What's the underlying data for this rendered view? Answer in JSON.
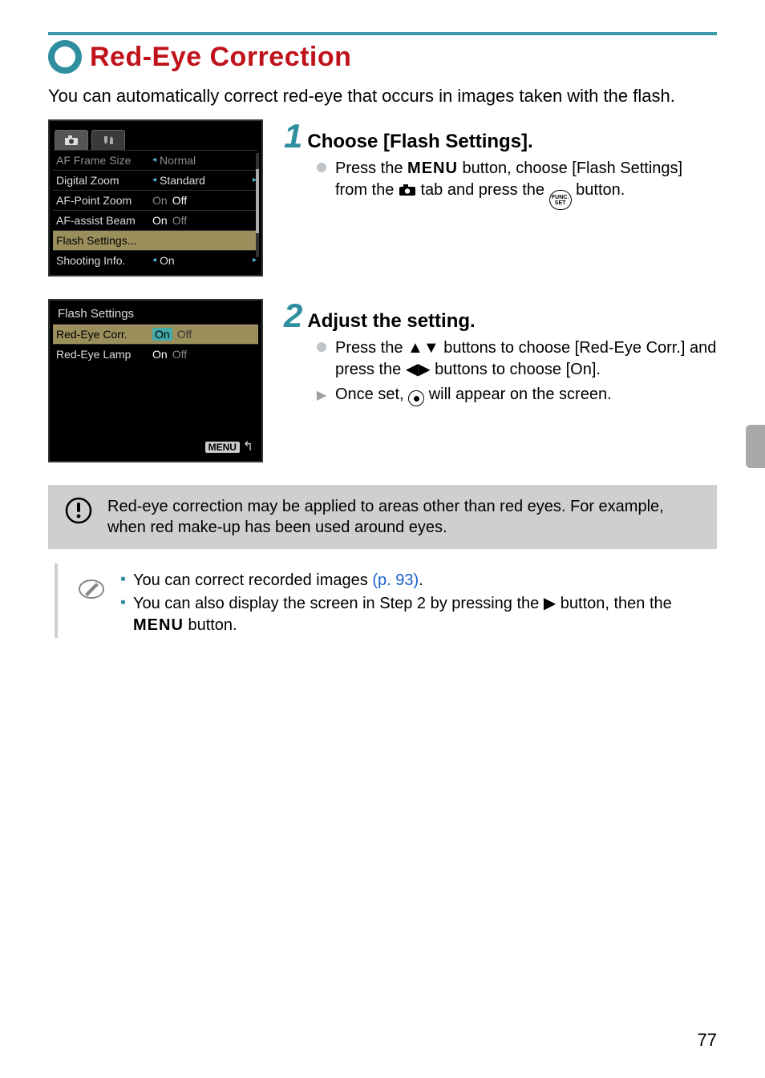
{
  "title": "Red-Eye Correction",
  "intro": "You can automatically correct red-eye that occurs in images taken with the flash.",
  "lcd1": {
    "rows": [
      {
        "label": "AF Frame Size",
        "value": "Normal",
        "muted": true,
        "style": "caret"
      },
      {
        "label": "Digital Zoom",
        "value": "Standard",
        "style": "caret",
        "tail": true
      },
      {
        "label": "AF-Point Zoom",
        "on": "On",
        "off": "Off",
        "sel": "off",
        "style": "onoff"
      },
      {
        "label": "AF-assist Beam",
        "on": "On",
        "off": "Off",
        "sel": "on",
        "style": "onoff"
      },
      {
        "label": "Flash Settings...",
        "style": "highlight"
      },
      {
        "label": "Shooting Info.",
        "value": "On",
        "style": "caret",
        "tail": true
      }
    ]
  },
  "lcd2": {
    "title": "Flash Settings",
    "rows": [
      {
        "label": "Red-Eye Corr.",
        "on": "On",
        "off": "Off",
        "sel": "on",
        "style": "onoff-box",
        "highlight": true
      },
      {
        "label": "Red-Eye Lamp",
        "on": "On",
        "off": "Off",
        "sel": "on",
        "style": "onoff"
      }
    ],
    "menu_back": "MENU"
  },
  "step1": {
    "num": "1",
    "title": "Choose [Flash Settings].",
    "b1a": "Press the ",
    "b1_menu": "MENU",
    "b1b": " button, choose [Flash Settings] from the ",
    "b1c": " tab and press the ",
    "b1_func_top": "FUNC.",
    "b1_func_bot": "SET",
    "b1d": " button."
  },
  "step2": {
    "num": "2",
    "title": "Adjust the setting.",
    "b1a": "Press the ",
    "b1b": " buttons to choose [Red-Eye Corr.] and press the ",
    "b1c": " buttons to choose [On].",
    "b2a": "Once set, ",
    "b2b": " will appear on the screen."
  },
  "caution": "Red-eye correction may be applied to areas other than red eyes. For example, when red make-up has been used around eyes.",
  "note": {
    "li1a": "You can correct recorded images ",
    "li1_link": "(p. 93)",
    "li1b": ".",
    "li2a": "You can also display the screen in Step 2 by pressing the ",
    "li2b": " button, then the ",
    "li2_menu": "MENU",
    "li2c": " button."
  },
  "page_number": "77"
}
